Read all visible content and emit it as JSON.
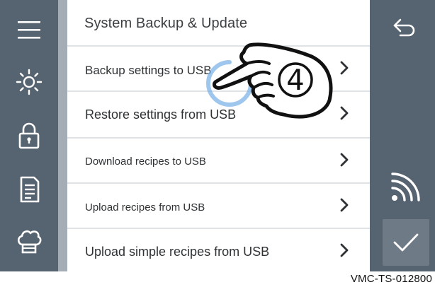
{
  "colors": {
    "sidebar_bg": "#566371",
    "sidebar_divider": "#a4adb6",
    "content_bg": "#ffffff",
    "icon_color": "#ffffff",
    "confirm_button_bg": "#6e7a85",
    "text_dark": "#2f3235",
    "row_separator": "#dfe3e6",
    "spinner": "#7fb3e6"
  },
  "left_sidebar": {
    "items": [
      {
        "icon": "menu-icon"
      },
      {
        "icon": "brightness-icon"
      },
      {
        "icon": "lock-icon"
      },
      {
        "icon": "document-icon"
      },
      {
        "icon": "chef-hat-icon"
      }
    ]
  },
  "main": {
    "title": "System Backup & Update",
    "items": [
      {
        "label": "Backup settings to USB"
      },
      {
        "label": "Restore settings from USB"
      },
      {
        "label": "Download recipes to USB"
      },
      {
        "label": "Upload recipes from USB"
      },
      {
        "label": "Upload simple recipes from USB"
      }
    ]
  },
  "right_sidebar": {
    "back_icon": "back-arrow-icon",
    "wireless_icon": "wireless-icon",
    "confirm_icon": "checkmark-icon"
  },
  "overlay": {
    "step_number": "4",
    "icon": "pointing-hand-icon"
  },
  "footer": {
    "doc_code": "VMC-TS-012800"
  }
}
